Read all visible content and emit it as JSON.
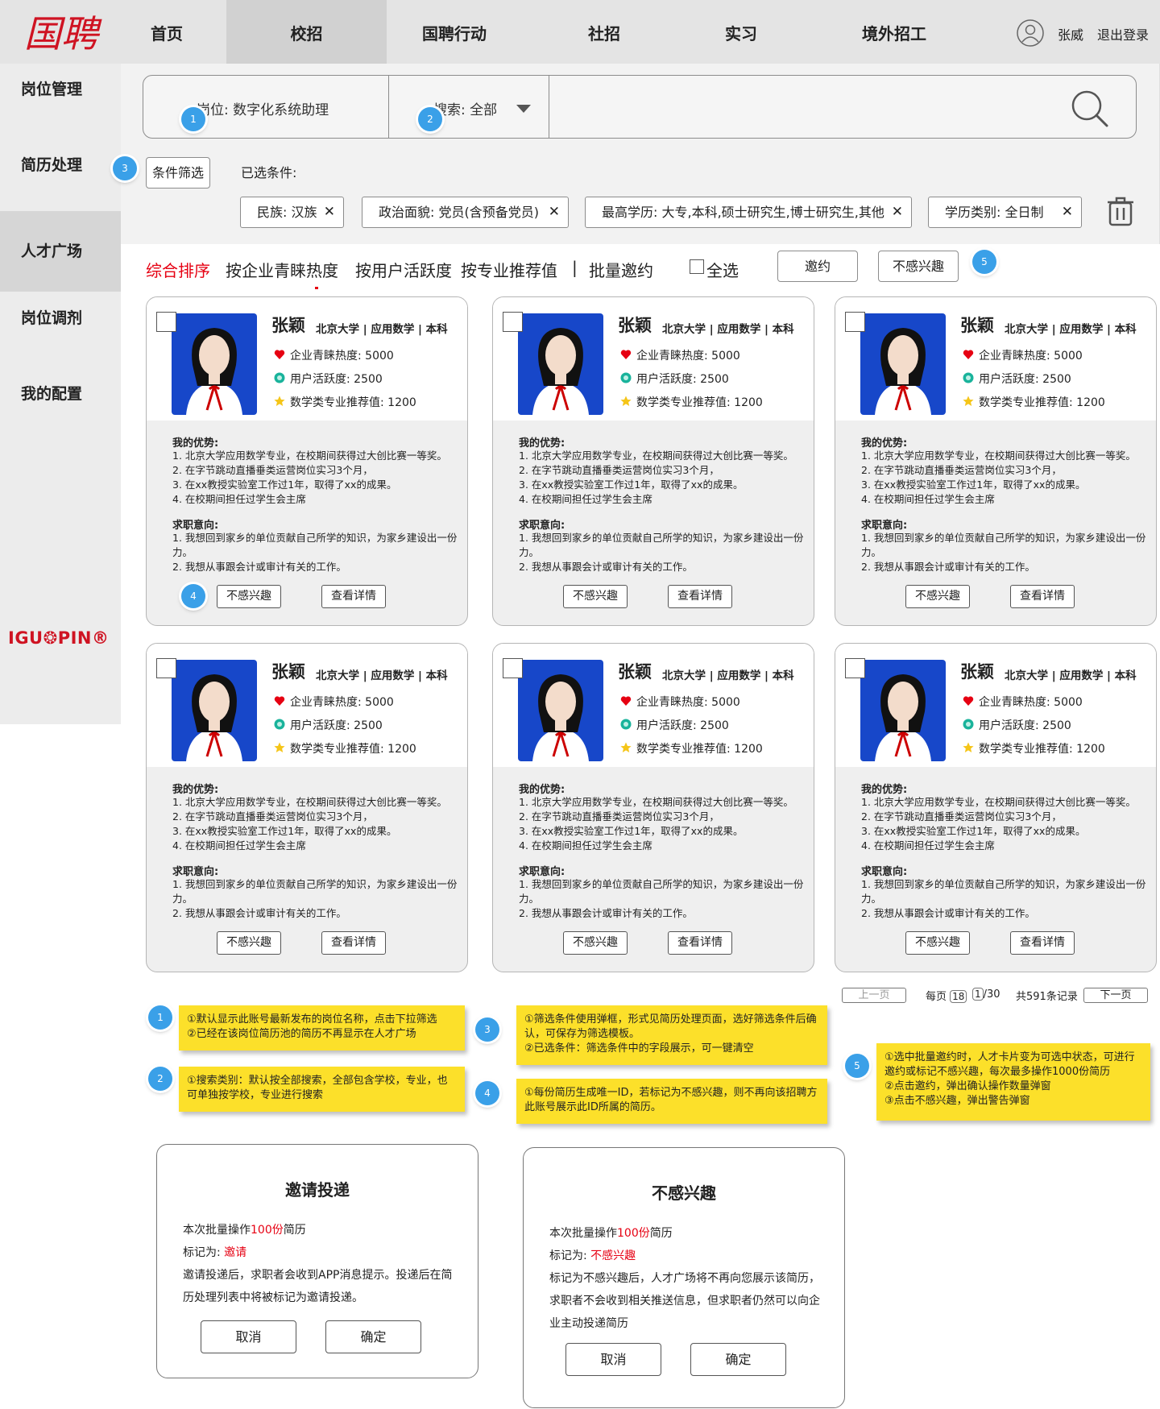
{
  "nav": {
    "logo_text": "国聘",
    "items": [
      {
        "label": "首页"
      },
      {
        "label": "校招"
      },
      {
        "label": "国聘行动"
      },
      {
        "label": "社招"
      },
      {
        "label": "实习"
      },
      {
        "label": "境外招工"
      }
    ],
    "active_index": 1,
    "user_name": "张威",
    "logout_label": "退出登录"
  },
  "sidebar": {
    "items": [
      {
        "label": "岗位管理"
      },
      {
        "label": "简历处理"
      },
      {
        "label": "人才广场"
      },
      {
        "label": "岗位调剂"
      },
      {
        "label": "我的配置"
      }
    ],
    "active_index": 2,
    "brand": "IGU❂PIN®"
  },
  "search": {
    "position_label": "岗位: 数字化系统助理",
    "category_label": "搜索: 全部",
    "placeholder": "",
    "filter_button": "条件筛选",
    "selected_label": "已选条件:",
    "chips": [
      {
        "label": "民族: 汉族"
      },
      {
        "label": "政治面貌: 党员(含预备党员)"
      },
      {
        "label": "最高学历: 大专,本科,硕士研究生,博士研究生,其他"
      },
      {
        "label": "学历类别: 全日制"
      }
    ],
    "chip_close": "✕"
  },
  "sort": {
    "items": [
      {
        "label": "综合排序"
      },
      {
        "label": "按企业青睐热度"
      },
      {
        "label": "按用户活跃度"
      },
      {
        "label": "按专业推荐值"
      },
      {
        "label": "批量邀约"
      }
    ],
    "active_index": 0,
    "separator": "|",
    "select_all": "全选",
    "invite_button": "邀约",
    "not_interested_button": "不感兴趣"
  },
  "markers": [
    "1",
    "2",
    "3",
    "4",
    "5"
  ],
  "card_template": {
    "name": "张颖",
    "meta": "北京大学 | 应用数学 | 本科",
    "stat1": "企业青睐热度: 5000",
    "stat2": "用户活跃度: 2500",
    "stat3": "数学类专业推荐值: 1200",
    "adv_title": "我的优势:",
    "adv_lines": [
      "1. 北京大学应用数学专业，在校期间获得过大创比赛一等奖。",
      "2. 在字节跳动直播垂类运营岗位实习3个月，",
      "3. 在xx教授实验室工作过1年，取得了xx的成果。",
      "4. 在校期间担任过学生会主席"
    ],
    "intent_title": "求职意向:",
    "intent_lines": [
      "1. 我想回到家乡的单位贡献自己所学的知识，为家乡建设出一份力。",
      "2. 我想从事跟会计或审计有关的工作。"
    ],
    "btn_not_interested": "不感兴趣",
    "btn_detail": "查看详情"
  },
  "pagination": {
    "prev": "上一页",
    "per_page_prefix": "每页",
    "per_page": "18",
    "current_page": "1",
    "total_pages_suffix": "/30",
    "total_records": "共591条记录",
    "next": "下一页"
  },
  "notes": [
    {
      "marker": "1",
      "lines": [
        "①默认显示此账号最新发布的岗位名称，点击下拉筛选",
        "②已经在该岗位简历池的简历不再显示在人才广场"
      ]
    },
    {
      "marker": "2",
      "lines": [
        "①搜索类别：默认按全部搜索，全部包含学校，专业，也可单独按学校，专业进行搜索"
      ]
    },
    {
      "marker": "3",
      "lines": [
        "①筛选条件使用弹框，形式见简历处理页面，选好筛选条件后确认，可保存为筛选模板。",
        "②已选条件：筛选条件中的字段展示，可一键清空"
      ]
    },
    {
      "marker": "4",
      "lines": [
        "①每份简历生成唯一ID，若标记为不感兴趣，则不再向该招聘方此账号展示此ID所属的简历。"
      ]
    },
    {
      "marker": "5",
      "lines": [
        "①选中批量邀约时，人才卡片变为可选中状态，可进行邀约或标记不感兴趣，每次最多操作1000份简历",
        "②点击邀约，弹出确认操作数量弹窗",
        "③点击不感兴趣，弹出警告弹窗"
      ]
    }
  ],
  "dialog_invite": {
    "title": "邀请投递",
    "line1_prefix": "本次批量操作",
    "line1_count": "100份",
    "line1_suffix": "简历",
    "line2_prefix": "标记为:",
    "line2_value": "邀请",
    "body": "邀请投递后，求职者会收到APP消息提示。投递后在简历处理列表中将被标记为邀请投递。",
    "cancel": "取消",
    "confirm": "确定"
  },
  "dialog_reject": {
    "title": "不感兴趣",
    "line1_prefix": "本次批量操作",
    "line1_count": "100份",
    "line1_suffix": "简历",
    "line2_prefix": "标记为:",
    "line2_value": "不感兴趣",
    "body": "标记为不感兴趣后，人才广场将不再向您展示该简历，求职者不会收到相关推送信息，但求职者仍然可以向企业主动投递简历",
    "cancel": "取消",
    "confirm": "确定"
  },
  "colors": {
    "accent": "#e60012",
    "marker": "#3aa0e8",
    "note": "#fce02a",
    "photo_bg": "#1747c9"
  }
}
